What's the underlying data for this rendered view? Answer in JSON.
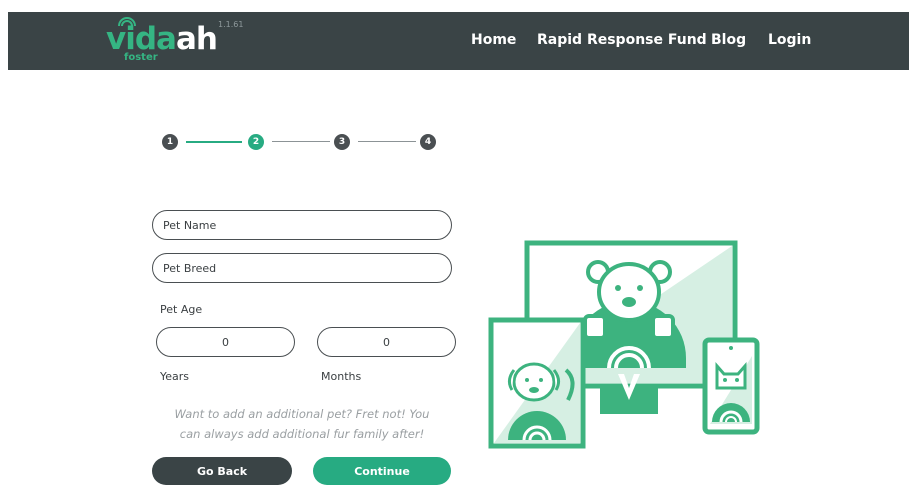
{
  "header": {
    "logo_primary": "vida",
    "logo_secondary": "ah",
    "logo_sub": "foster",
    "version": "1.1.61",
    "nav": [
      "Home",
      "Rapid Response Fund",
      "Blog",
      "Login"
    ]
  },
  "stepper": {
    "steps": [
      "1",
      "2",
      "3",
      "4"
    ],
    "current_step": 2
  },
  "form": {
    "pet_name_placeholder": "Pet Name",
    "pet_breed_placeholder": "Pet Breed",
    "pet_age_label": "Pet Age",
    "years_value": "0",
    "months_value": "0",
    "years_label": "Years",
    "months_label": "Months",
    "helper_line1": "Want to add an additional pet? Fret not! You",
    "helper_line2": "can always add additional fur family after!",
    "back_label": "Go Back",
    "continue_label": "Continue"
  },
  "colors": {
    "header_bg": "#3a4446",
    "brand_green": "#27ab82",
    "illustration_green": "#3db37f",
    "dark_button": "#3a4446"
  },
  "illustration": {
    "icons": [
      "monitor-dog-icon",
      "tablet-dog-icon",
      "phone-cat-icon"
    ]
  }
}
